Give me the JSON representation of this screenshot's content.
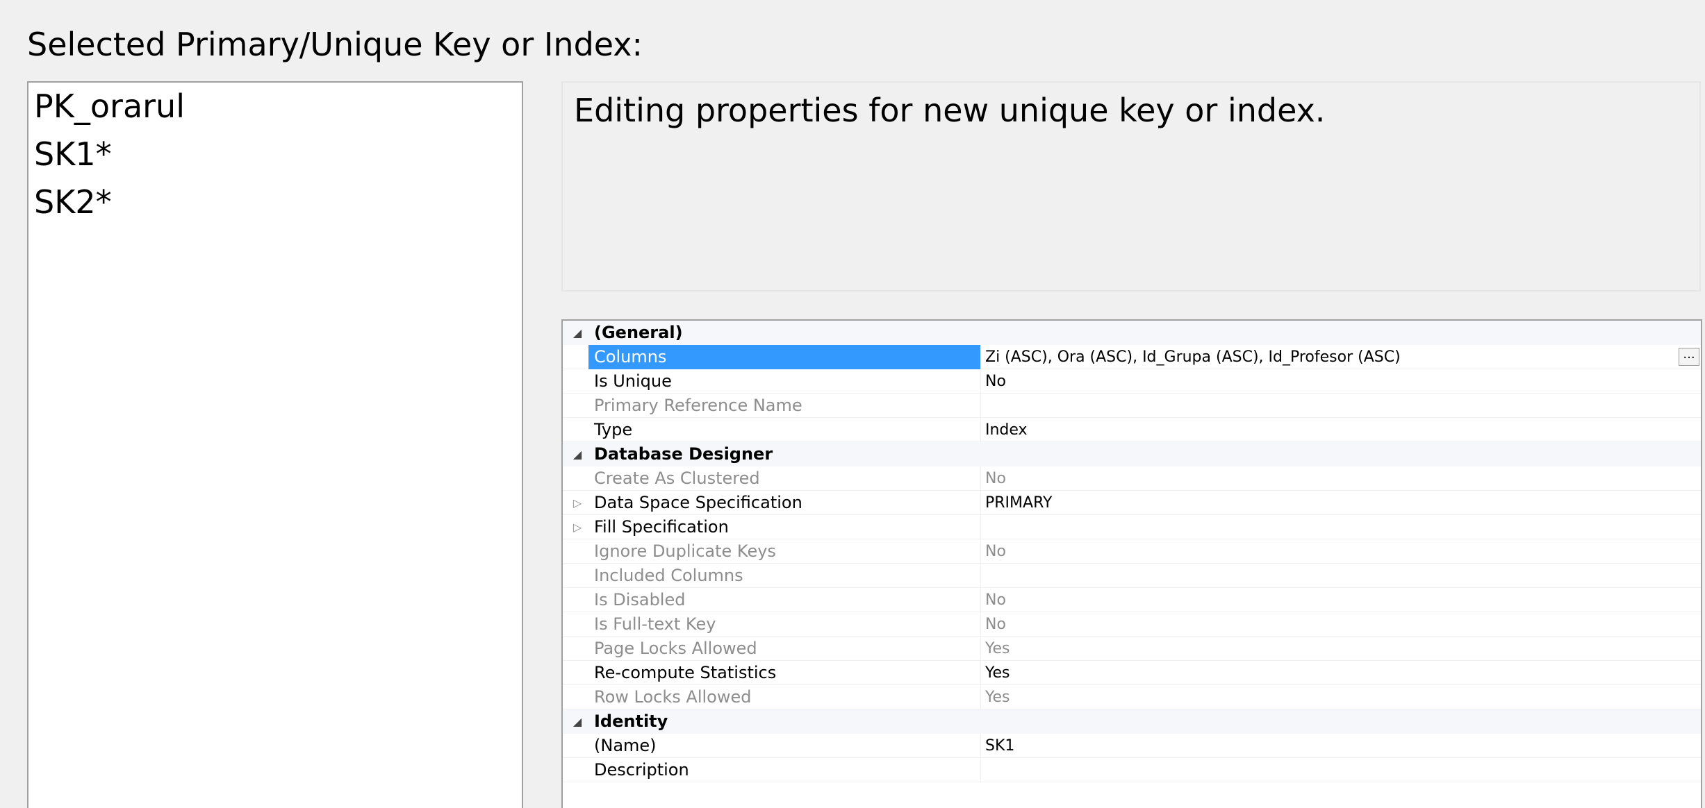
{
  "header": {
    "selected_label": "Selected Primary/Unique Key or Index:"
  },
  "key_list": {
    "items": [
      {
        "label": "PK_orarul"
      },
      {
        "label": "SK1*"
      },
      {
        "label": "SK2*"
      }
    ]
  },
  "description": {
    "text": "Editing properties for new unique key or index."
  },
  "property_grid": {
    "categories": [
      {
        "label": "(General)",
        "expanded": true,
        "rows": [
          {
            "name": "Columns",
            "value": "Zi (ASC), Ora (ASC), Id_Grupa (ASC), Id_Profesor (ASC)",
            "selected": true,
            "has_button": true,
            "button_label": "...",
            "dim": false
          },
          {
            "name": "Is Unique",
            "value": "No",
            "dim": false
          },
          {
            "name": "Primary Reference Name",
            "value": "",
            "dim": true
          },
          {
            "name": "Type",
            "value": "Index",
            "dim": false
          }
        ]
      },
      {
        "label": "Database Designer",
        "expanded": true,
        "rows": [
          {
            "name": "Create As Clustered",
            "value": "No",
            "dim": true
          },
          {
            "name": "Data Space Specification",
            "value": "PRIMARY",
            "dim": false,
            "expandable": true
          },
          {
            "name": "Fill Specification",
            "value": "",
            "dim": false,
            "expandable": true
          },
          {
            "name": "Ignore Duplicate Keys",
            "value": "No",
            "dim": true
          },
          {
            "name": "Included Columns",
            "value": "",
            "dim": true
          },
          {
            "name": "Is Disabled",
            "value": "No",
            "dim": true
          },
          {
            "name": "Is Full-text Key",
            "value": "No",
            "dim": true
          },
          {
            "name": "Page Locks Allowed",
            "value": "Yes",
            "dim": true
          },
          {
            "name": "Re-compute Statistics",
            "value": "Yes",
            "dim": false
          },
          {
            "name": "Row Locks Allowed",
            "value": "Yes",
            "dim": true
          }
        ]
      },
      {
        "label": "Identity",
        "expanded": true,
        "rows": [
          {
            "name": "(Name)",
            "value": "SK1",
            "dim": false
          },
          {
            "name": "Description",
            "value": "",
            "dim": false
          }
        ]
      }
    ],
    "collapse_glyph": "◢",
    "expand_glyph": "▷"
  }
}
